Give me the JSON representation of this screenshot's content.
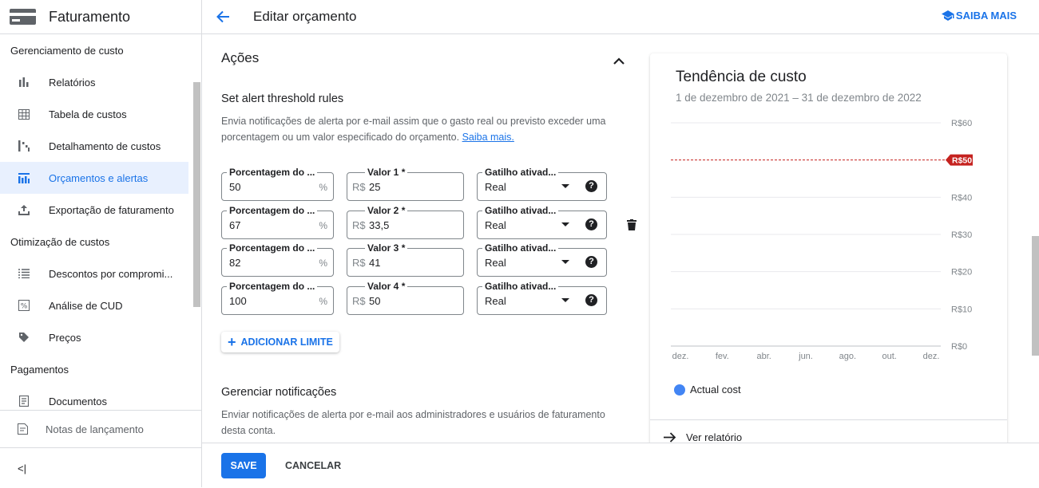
{
  "app": {
    "title": "Faturamento"
  },
  "sidebar": {
    "sections": [
      {
        "label": "Gerenciamento de custo"
      },
      {
        "label": "Otimização de custos"
      },
      {
        "label": "Pagamentos"
      }
    ],
    "items": [
      {
        "label": "Relatórios",
        "icon": "bar-chart-icon"
      },
      {
        "label": "Tabela de custos",
        "icon": "table-icon"
      },
      {
        "label": "Detalhamento de custos",
        "icon": "breakdown-icon"
      },
      {
        "label": "Orçamentos e alertas",
        "icon": "budget-icon",
        "active": true
      },
      {
        "label": "Exportação de faturamento",
        "icon": "export-icon"
      },
      {
        "label": "Descontos por compromi...",
        "icon": "list-icon"
      },
      {
        "label": "Análise de CUD",
        "icon": "percent-icon"
      },
      {
        "label": "Preços",
        "icon": "tag-icon"
      },
      {
        "label": "Documentos",
        "icon": "document-icon"
      }
    ],
    "release_notes": "Notas de lançamento",
    "collapse_label": "<|"
  },
  "header": {
    "title": "Editar orçamento",
    "learn_more": "SAIBA MAIS"
  },
  "actions": {
    "title": "Ações",
    "rules_title": "Set alert threshold rules",
    "rules_desc": "Envia notificações de alerta por e-mail assim que o gasto real ou previsto exceder uma porcentagem ou um valor especificado do orçamento.",
    "rules_link": "Saiba mais.",
    "thresholds": [
      {
        "pct_label": "Porcentagem do ...",
        "pct": "50",
        "pct_suffix": "%",
        "value_label": "Valor 1 *",
        "currency": "R$",
        "value": "25",
        "trigger_label": "Gatilho ativad...",
        "trigger": "Real"
      },
      {
        "pct_label": "Porcentagem do ...",
        "pct": "67",
        "pct_suffix": "%",
        "value_label": "Valor 2 *",
        "currency": "R$",
        "value": "33,5",
        "trigger_label": "Gatilho ativad...",
        "trigger": "Real"
      },
      {
        "pct_label": "Porcentagem do ...",
        "pct": "82",
        "pct_suffix": "%",
        "value_label": "Valor 3 *",
        "currency": "R$",
        "value": "41",
        "trigger_label": "Gatilho ativad...",
        "trigger": "Real"
      },
      {
        "pct_label": "Porcentagem do ...",
        "pct": "100",
        "pct_suffix": "%",
        "value_label": "Valor 4 *",
        "currency": "R$",
        "value": "50",
        "trigger_label": "Gatilho ativad...",
        "trigger": "Real"
      }
    ],
    "add_button": "ADICIONAR LIMITE",
    "help_glyph": "?",
    "notif_title": "Gerenciar notificações",
    "notif_desc": "Enviar notificações de alerta por e-mail aos administradores e usuários de faturamento desta conta."
  },
  "trend": {
    "title": "Tendência de custo",
    "subtitle": "1 de dezembro de 2021 – 31 de dezembro de 2022",
    "legend": "Actual cost",
    "view_report": "Ver relatório"
  },
  "chart_data": {
    "type": "line",
    "title": "Tendência de custo",
    "x_ticks": [
      "dez.",
      "fev.",
      "abr.",
      "jun.",
      "ago.",
      "out.",
      "dez."
    ],
    "y_ticks": [
      "R$0",
      "R$10",
      "R$20",
      "R$30",
      "R$40",
      "R$60"
    ],
    "ylim": [
      0,
      60
    ],
    "y_tick_values": [
      0,
      10,
      20,
      30,
      40,
      60
    ],
    "budget_line": {
      "value": 50,
      "label": "R$50",
      "color": "#c5221f"
    },
    "series": [
      {
        "name": "Actual cost",
        "values": [],
        "color": "#4285f4"
      }
    ],
    "grid": true
  },
  "footer": {
    "save": "SAVE",
    "cancel": "CANCELAR"
  },
  "colors": {
    "accent": "#1a73e8",
    "active_bg": "#e8f0fe",
    "budget": "#c5221f"
  }
}
